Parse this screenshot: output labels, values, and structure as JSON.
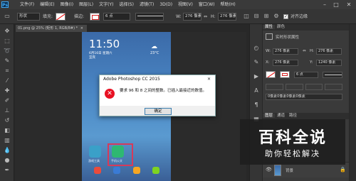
{
  "app": {
    "logo": "Ps"
  },
  "menu": [
    "文件(F)",
    "编辑(E)",
    "图像(I)",
    "图层(L)",
    "文字(Y)",
    "选择(S)",
    "滤镜(T)",
    "3D(D)",
    "视图(V)",
    "窗口(W)",
    "帮助(H)"
  ],
  "window_controls": {
    "minimize": "–",
    "maximize": "□",
    "close": "✕"
  },
  "options": {
    "mode_label": "形状",
    "fill_label": "填充:",
    "stroke_label": "描边:",
    "stroke_width": "6 点",
    "w_label": "W:",
    "w_value": "276 像素",
    "link_symbol": "⇔",
    "h_label": "H:",
    "h_value": "276 像素",
    "align_edges_label": "对齐边缘"
  },
  "document_tab": {
    "title": "01.png @ 25% (矩形 1, RGB/8#) *",
    "close": "×"
  },
  "phone": {
    "time": "11:50",
    "date": "6月16日 星期六",
    "location": "宜宾",
    "temperature": "23°C",
    "apps": [
      {
        "label": "游戏工具",
        "color": "#3aa0c8"
      },
      {
        "label": "手机公文",
        "color": "#2eb872"
      }
    ],
    "dock_colors": [
      "#e94b3c",
      "#3a7bd5",
      "#f5a623",
      "#7ed321"
    ]
  },
  "dialog": {
    "title": "Adobe Photoshop CC 2015",
    "close": "✕",
    "error_symbol": "✕",
    "message": "要求 96 和 8 之间的整数。已插入最接近的数值。",
    "ok_label": "确定"
  },
  "properties": {
    "tabs": [
      "属性",
      "颜色"
    ],
    "header": "实时形状属性",
    "w_label": "W:",
    "w_value": "276 像素",
    "h_label": "H:",
    "h_value": "276 像素",
    "x_label": "X:",
    "x_value": "276 像素",
    "y_label": "Y:",
    "y_value": "1240 像素",
    "stroke_width": "6 点",
    "corner_radius": "0像素0像素0像素0像素"
  },
  "layers": {
    "tabs": [
      "图层",
      "通道",
      "路径"
    ],
    "layer_name": "背景"
  },
  "watermark": {
    "title": "百科全说",
    "subtitle": "助你轻松解决"
  }
}
